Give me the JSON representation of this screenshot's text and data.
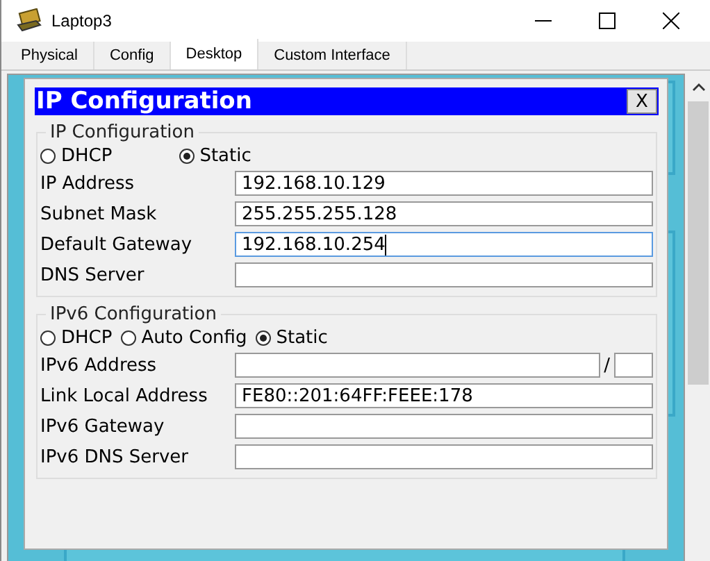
{
  "window": {
    "title": "Laptop3"
  },
  "tabs": [
    {
      "label": "Physical",
      "selected": false
    },
    {
      "label": "Config",
      "selected": false
    },
    {
      "label": "Desktop",
      "selected": true
    },
    {
      "label": "Custom Interface",
      "selected": false
    }
  ],
  "dialog": {
    "title": "IP Configuration",
    "close": "X",
    "groups": [
      {
        "legend": "IP Configuration",
        "modes": [
          {
            "label": "DHCP",
            "selected": false
          },
          {
            "label": "Static",
            "selected": true
          }
        ],
        "fields": [
          {
            "label": "IP Address",
            "value": "192.168.10.129",
            "focused": false,
            "kind": "plain"
          },
          {
            "label": "Subnet Mask",
            "value": "255.255.255.128",
            "focused": false,
            "kind": "plain"
          },
          {
            "label": "Default Gateway",
            "value": "192.168.10.254",
            "focused": true,
            "kind": "plain"
          },
          {
            "label": "DNS Server",
            "focused": false,
            "kind": "plain"
          }
        ]
      },
      {
        "legend": "IPv6 Configuration",
        "modes": [
          {
            "label": "DHCP",
            "selected": false
          },
          {
            "label": "Auto Config",
            "selected": false
          },
          {
            "label": "Static",
            "selected": true
          }
        ],
        "fields": [
          {
            "label": "IPv6 Address",
            "focused": false,
            "kind": "prefixed",
            "separator": "/"
          },
          {
            "label": "Link Local Address",
            "value": "FE80::201:64FF:FEEE:178",
            "focused": false,
            "kind": "plain"
          },
          {
            "label": "IPv6 Gateway",
            "focused": false,
            "kind": "plain"
          },
          {
            "label": "IPv6 DNS Server",
            "focused": false,
            "kind": "plain"
          }
        ]
      }
    ]
  }
}
